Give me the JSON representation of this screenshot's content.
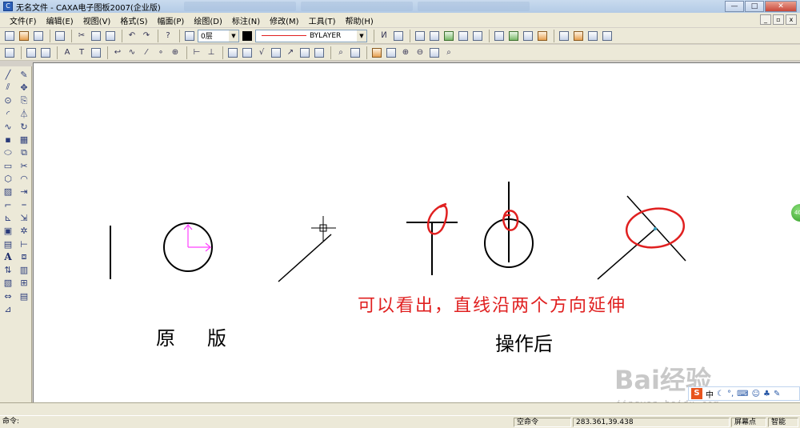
{
  "window": {
    "title": "无名文件 - CAXA电子图板2007(企业版)",
    "buttons": [
      "—",
      "□",
      "✕"
    ]
  },
  "menu": [
    "文件(F)",
    "编辑(E)",
    "视图(V)",
    "格式(S)",
    "幅面(P)",
    "绘图(D)",
    "标注(N)",
    "修改(M)",
    "工具(T)",
    "帮助(H)"
  ],
  "toolbar": {
    "layer_value": "0层",
    "linetype_value": "BYLAYER",
    "color_accent": "#e02020"
  },
  "left_tools": [
    "line-icon",
    "pen-icon",
    "parallel-icon",
    "move-icon",
    "circle-icon",
    "copy-icon",
    "arc-icon",
    "mirror-icon",
    "spline-icon",
    "rotate-icon",
    "point-icon",
    "array-icon",
    "ellipse-icon",
    "scale-icon",
    "rectangle-icon",
    "trim-icon",
    "polygon-icon",
    "fillet-icon",
    "hatch-icon",
    "extend-icon",
    "polyline-icon",
    "break-icon",
    "centerline-icon",
    "stretch-icon",
    "block-icon",
    "explode-icon",
    "image-icon",
    "dimension-icon"
  ],
  "left_text_tool": "A",
  "canvas": {
    "note": "可以看出，直线沿两个方向延伸",
    "label_original": "原版",
    "label_after": "操作后",
    "note_color": "#e02020",
    "pink_color": "#ff40ff"
  },
  "status": {
    "command_label": "命令:",
    "empty_command": "空命令",
    "coordinates": "283.361,39.438",
    "snap_mode": "屏幕点",
    "smart": "智能"
  },
  "watermark": {
    "brand": "Bai经验",
    "url": "jingyan.baidu.com"
  },
  "ime": {
    "logo": "S",
    "mode": "中"
  },
  "side_widget": "40"
}
